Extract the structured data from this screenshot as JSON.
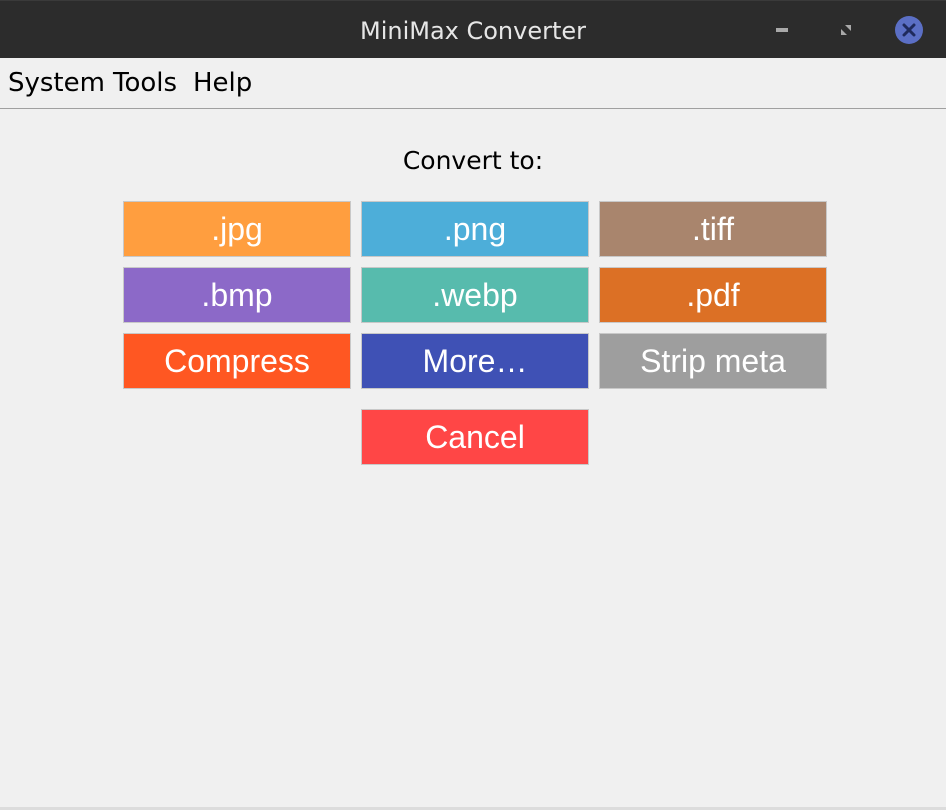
{
  "window": {
    "title": "MiniMax Converter"
  },
  "window_controls": {
    "minimize_icon": "minimize-icon",
    "maximize_icon": "maximize-icon",
    "close_icon": "close-icon",
    "close_color": "#5b6fc5"
  },
  "menubar": {
    "items": [
      {
        "label": "System"
      },
      {
        "label": "Tools"
      },
      {
        "label": "Help"
      }
    ]
  },
  "main": {
    "heading": "Convert to:",
    "buttons": [
      {
        "label": ".jpg",
        "color": "#ff9e3f"
      },
      {
        "label": ".png",
        "color": "#4daed9"
      },
      {
        "label": ".tiff",
        "color": "#a9856d"
      },
      {
        "label": ".bmp",
        "color": "#8c69c8"
      },
      {
        "label": ".webp",
        "color": "#57bbad"
      },
      {
        "label": ".pdf",
        "color": "#dc7025"
      },
      {
        "label": "Compress",
        "color": "#ff5722"
      },
      {
        "label": "More…",
        "color": "#3f51b5"
      },
      {
        "label": "Strip meta",
        "color": "#9e9e9e"
      }
    ],
    "cancel": {
      "label": "Cancel",
      "color": "#ff4646"
    }
  }
}
